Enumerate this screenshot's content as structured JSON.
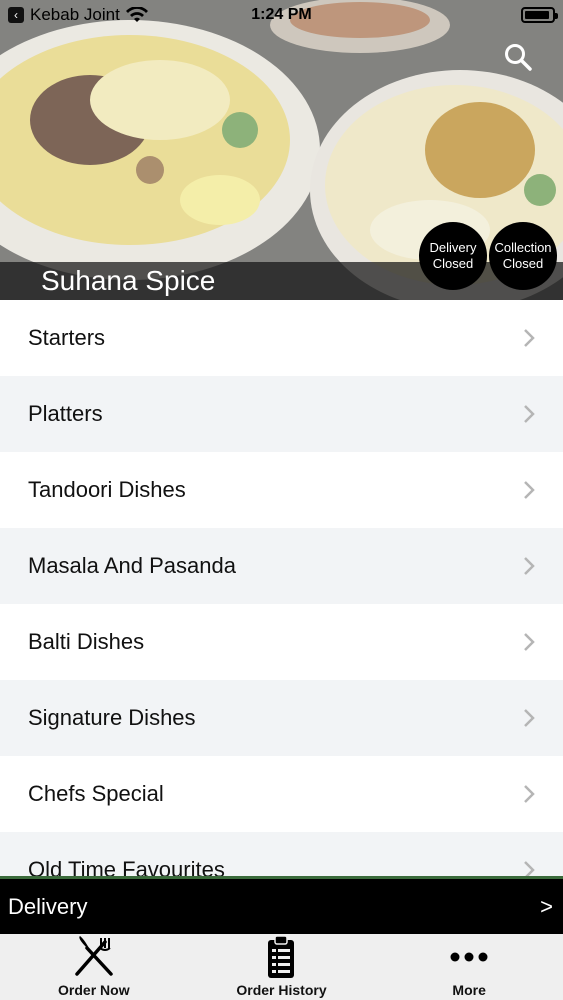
{
  "status_bar": {
    "back_app": "Kebab Joint",
    "time": "1:24 PM"
  },
  "hero": {
    "restaurant_name": "Suhana Spice",
    "delivery_status": [
      "Delivery",
      "Closed"
    ],
    "collection_status": [
      "Collection",
      "Closed"
    ]
  },
  "menu": {
    "items": [
      {
        "label": "Starters"
      },
      {
        "label": "Platters"
      },
      {
        "label": "Tandoori Dishes"
      },
      {
        "label": "Masala And Pasanda"
      },
      {
        "label": "Balti Dishes"
      },
      {
        "label": "Signature Dishes"
      },
      {
        "label": "Chefs Special"
      },
      {
        "label": "Old Time Favourites"
      }
    ]
  },
  "delivery_bar": {
    "label": "Delivery",
    "arrow": ">"
  },
  "tab_bar": {
    "tabs": [
      {
        "label": "Order Now",
        "icon": "fork-knife-icon"
      },
      {
        "label": "Order History",
        "icon": "clipboard-list-icon"
      },
      {
        "label": "More",
        "icon": "more-dots-icon"
      }
    ]
  },
  "colors": {
    "title_bar_bg": "#141414",
    "status_circle_bg": "#000000",
    "row_alt_bg": "#f2f4f6",
    "delivery_bar_bg": "#000000",
    "tab_bar_bg": "#efefef"
  }
}
